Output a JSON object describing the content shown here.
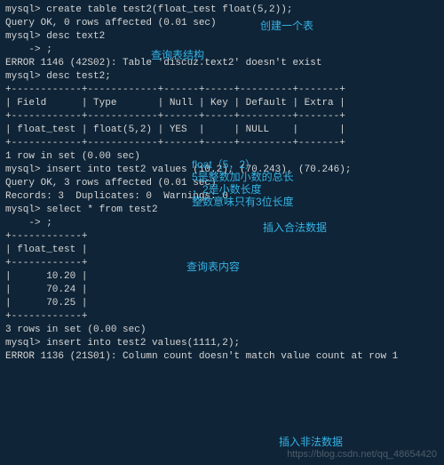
{
  "terminal": {
    "lines": [
      "mysql> create table test2(float_test float(5,2));",
      "Query OK, 0 rows affected (0.01 sec)",
      "",
      "mysql> desc text2",
      "    -> ;",
      "ERROR 1146 (42S02): Table 'discuz.text2' doesn't exist",
      "mysql> desc test2;",
      "+------------+------------+------+-----+---------+-------+",
      "| Field      | Type       | Null | Key | Default | Extra |",
      "+------------+------------+------+-----+---------+-------+",
      "| float_test | float(5,2) | YES  |     | NULL    |       |",
      "+------------+------------+------+-----+---------+-------+",
      "1 row in set (0.00 sec)",
      "",
      "mysql> insert into test2 values (10.2), (70.243), (70.246);",
      "Query OK, 3 rows affected (0.01 sec)",
      "Records: 3  Duplicates: 0  Warnings: 0",
      "",
      "mysql> select * from test2",
      "    -> ;",
      "+------------+",
      "| float_test |",
      "+------------+",
      "|      10.20 |",
      "|      70.24 |",
      "|      70.25 |",
      "+------------+",
      "3 rows in set (0.00 sec)",
      "",
      "mysql> insert into test2 values(1111,2);",
      "ERROR 1136 (21S01): Column count doesn't match value count at row 1"
    ]
  },
  "annotations": {
    "create_table": "创建一个表",
    "desc_struct": "查询表结构",
    "float_note1": "float（5，2）",
    "float_note2": "5是整数加小数的总长",
    "float_note3": "，2是小数长度",
    "float_note4": "整数意味只有3位长度",
    "insert_valid": "插入合法数据",
    "select_content": "查询表内容",
    "insert_invalid": "插入非法数据"
  },
  "watermark": "https://blog.csdn.net/qq_48654420"
}
